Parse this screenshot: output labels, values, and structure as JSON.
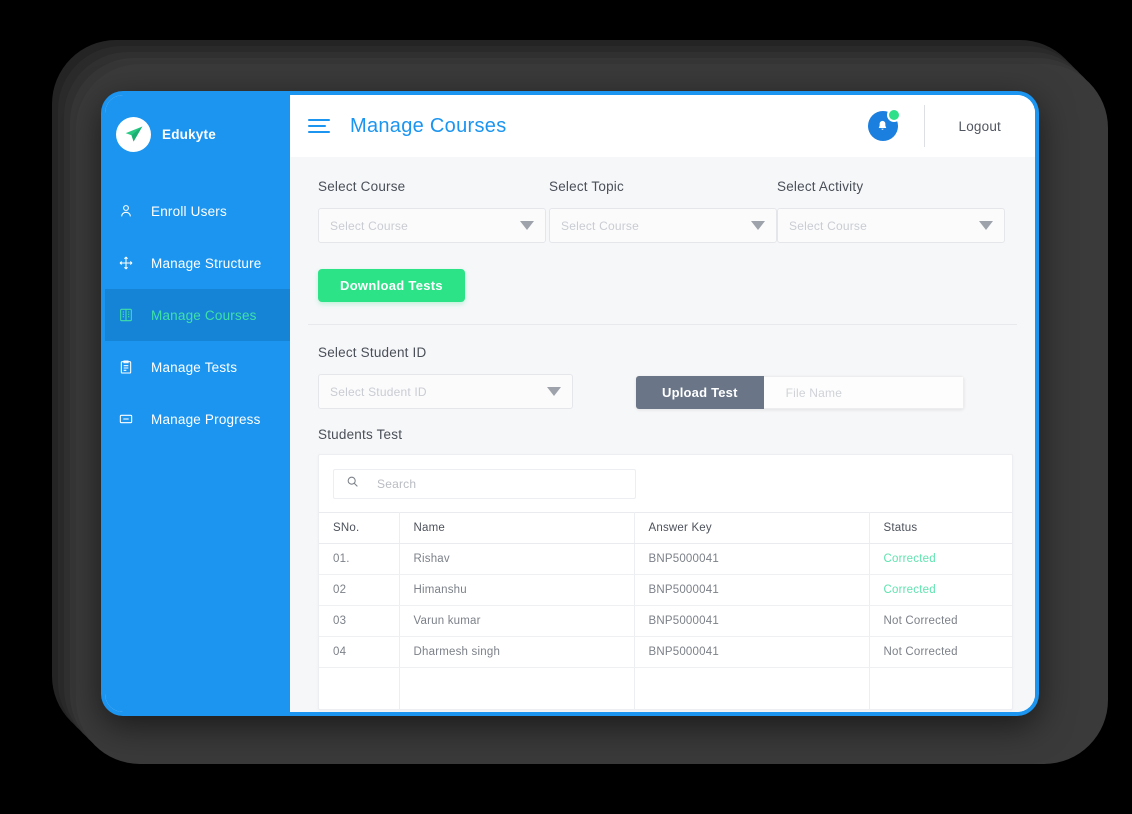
{
  "brand": {
    "name": "Edukyte",
    "logo_icon": "paper-plane-icon",
    "accent": "#1b95f0"
  },
  "sidebar": {
    "items": [
      {
        "label": "Enroll Users",
        "icon": "user-icon",
        "active": false
      },
      {
        "label": "Manage Structure",
        "icon": "move-cross-icon",
        "active": false
      },
      {
        "label": "Manage Courses",
        "icon": "book-icon",
        "active": true
      },
      {
        "label": "Manage Tests",
        "icon": "clipboard-icon",
        "active": false
      },
      {
        "label": "Manage Progress",
        "icon": "minus-box-icon",
        "active": false
      }
    ],
    "active_text_color": "#3fe0a8",
    "active_bg_color": "#1583d6"
  },
  "topbar": {
    "menu_icon": "hamburger-icon",
    "title": "Manage Courses",
    "bell_icon": "bell-icon",
    "bell_badge": "",
    "logout_label": "Logout"
  },
  "filters": {
    "course": {
      "label": "Select Course",
      "placeholder": "Select Course",
      "value": ""
    },
    "topic": {
      "label": "Select Topic",
      "placeholder": "Select Course",
      "value": ""
    },
    "activity": {
      "label": "Select Activity",
      "placeholder": "Select Course",
      "value": ""
    },
    "download_button": "Download Tests",
    "download_color": "#2ce388"
  },
  "upload": {
    "student_label": "Select Student ID",
    "student_placeholder": "Select Student ID",
    "student_value": "",
    "upload_button": "Upload Test",
    "upload_button_color": "#6a7687",
    "file_placeholder": "File Name",
    "file_value": ""
  },
  "students_test": {
    "title": "Students Test",
    "search_placeholder": "Search",
    "search_value": "",
    "search_icon": "search-icon",
    "columns": [
      "SNo.",
      "Name",
      "Answer Key",
      "Status"
    ],
    "rows": [
      {
        "sno": "01.",
        "name": "Rishav",
        "answer_key": "BNP5000041",
        "status": "Corrected",
        "status_state": "corrected"
      },
      {
        "sno": "02",
        "name": "Himanshu",
        "answer_key": "BNP5000041",
        "status": "Corrected",
        "status_state": "corrected"
      },
      {
        "sno": "03",
        "name": "Varun kumar",
        "answer_key": "BNP5000041",
        "status": "Not Corrected",
        "status_state": "not-corrected"
      },
      {
        "sno": "04",
        "name": "Dharmesh singh",
        "answer_key": "BNP5000041",
        "status": "Not Corrected",
        "status_state": "not-corrected"
      },
      {
        "sno": "",
        "name": "",
        "answer_key": "",
        "status": "",
        "status_state": "empty"
      }
    ],
    "status_colors": {
      "corrected": "#5fe3b0",
      "not_corrected": "#7c8189"
    }
  }
}
